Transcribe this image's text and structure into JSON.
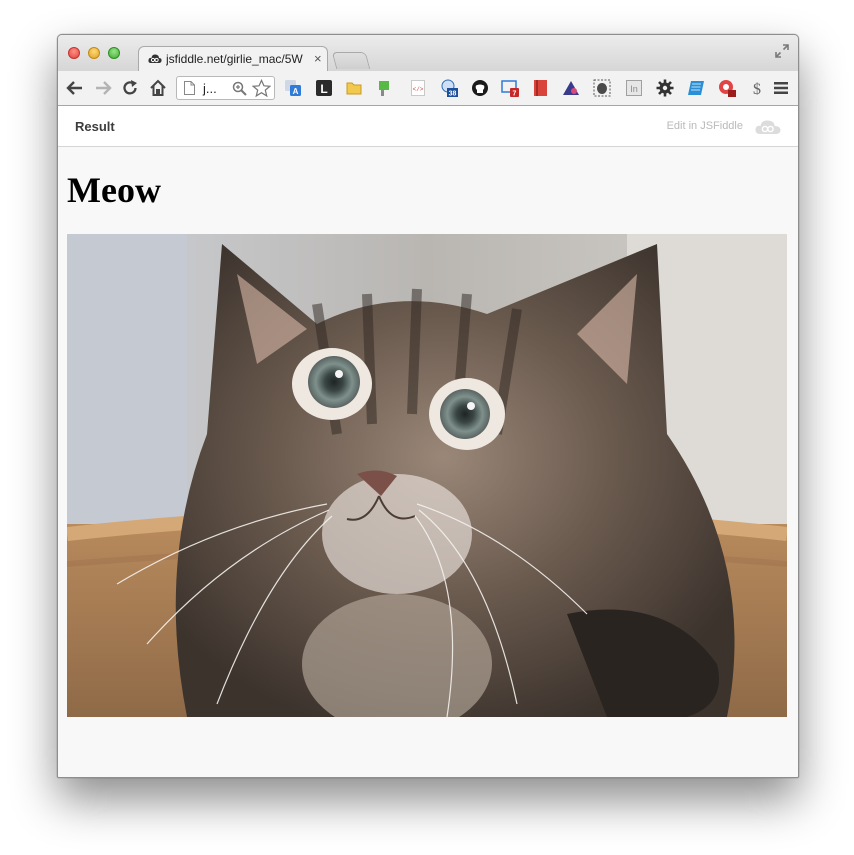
{
  "browser": {
    "tab": {
      "title": "jsfiddle.net/girlie_mac/5W",
      "close_glyph": "×"
    },
    "address_bar": {
      "text": "j..."
    },
    "extensions": [
      "translate-icon",
      "l-letter-icon",
      "folder-icon",
      "green-bag-icon",
      "code-page-icon",
      "badge-38-icon",
      "github-icon",
      "screen-capture-icon",
      "red-book-icon",
      "purple-ext-icon",
      "evernote-icon",
      "linkedin-icon",
      "gear-icon",
      "blue-note-icon",
      "red-circle-icon",
      "dollar-icon"
    ],
    "badges": {
      "count_badge": "38",
      "alert_badge": "7"
    }
  },
  "jsfiddle": {
    "result_label": "Result",
    "edit_link": "Edit in JSFiddle"
  },
  "page": {
    "heading": "Meow",
    "image_alt": "kitten photo"
  }
}
